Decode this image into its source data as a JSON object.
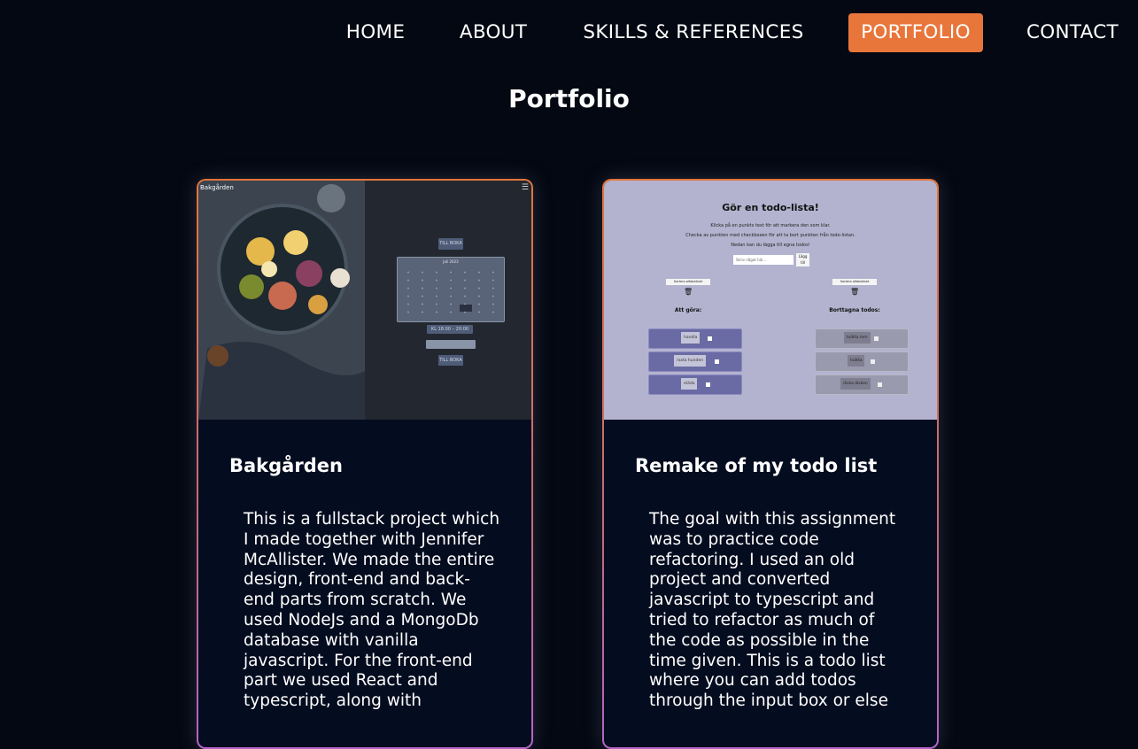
{
  "nav": {
    "items": [
      {
        "label": "HOME",
        "active": false
      },
      {
        "label": "ABOUT",
        "active": false
      },
      {
        "label": "SKILLS & REFERENCES",
        "active": false
      },
      {
        "label": "PORTFOLIO",
        "active": true
      },
      {
        "label": "CONTACT",
        "active": false
      }
    ]
  },
  "page": {
    "title": "Portfolio"
  },
  "colors": {
    "accent": "#e8763b",
    "background": "#040812",
    "card_bg": "#040c1f"
  },
  "projects": [
    {
      "title": "Bakgården",
      "description": "This is a fullstack project which I made together with Jennifer McAllister. We made the entire design, front-end and back-end parts from scratch. We used NodeJs and a MongoDb database with vanilla javascript. For the front-end part we used React and typescript, along with",
      "screenshot": {
        "logo": "Bakgården",
        "menu_icon": "hamburger-icon",
        "buttons": [
          "TILL BOKA",
          "KL 18:00 – 20:00",
          "",
          "TILL BOKA"
        ],
        "calendar_header": "Juli 2023"
      }
    },
    {
      "title": "Remake of my todo list",
      "description": "The goal with this assignment was to practice code refactoring. I used an old project and converted javascript to typescript and tried to refactor as much of the code as possible in the time given. This is a todo list where you can add todos through the input box or else",
      "screenshot": {
        "heading": "Gör en todo-lista!",
        "instructions": [
          "Klicka på en punkts text för att markera den som klar.",
          "Checka av punkten med checkboxen för att ta bort punkten från todo-listan.",
          "Nedan kan du lägga till egna todos!"
        ],
        "input_placeholder": "Skriv något här...",
        "add_button": "Lägg till",
        "sort_button": "Sortera alfabetiskt",
        "todo_heading": "Att göra:",
        "done_heading": "Borttagna todos:",
        "todos": [
          "handla",
          "rasta hunden",
          "städa"
        ],
        "done": [
          "tvätta mm",
          "tvätta",
          "diska disken"
        ]
      }
    }
  ]
}
